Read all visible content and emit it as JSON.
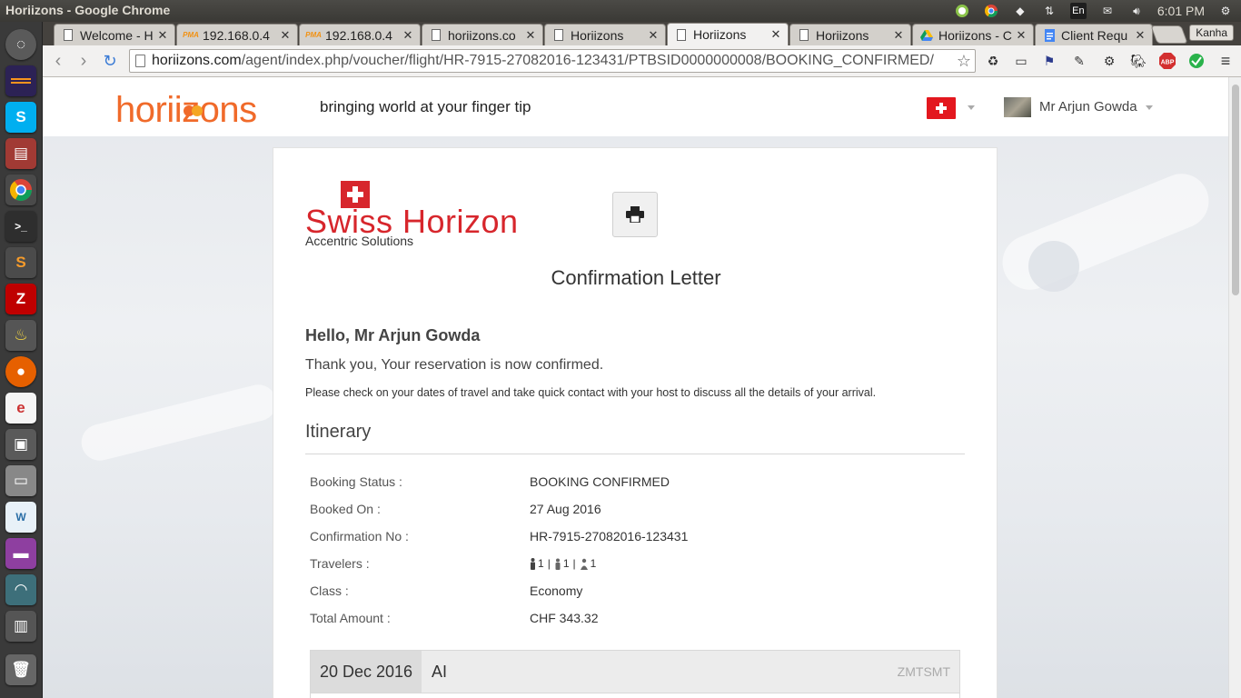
{
  "os": {
    "window_title": "Horiizons - Google Chrome",
    "keyboard": "En",
    "clock": "6:01 PM"
  },
  "launcher": {
    "items": [
      "dash-home",
      "eclipse",
      "skype",
      "files",
      "chrome",
      "terminal",
      "sublime-text",
      "filezilla",
      "unknown-app",
      "firefox",
      "editor",
      "save",
      "disk",
      "mysql-workbench",
      "media",
      "network",
      "archive",
      "trash"
    ]
  },
  "tabs": [
    {
      "label": "Welcome - H",
      "icon": "page-icon"
    },
    {
      "label": "192.168.0.4",
      "icon": "pma-icon"
    },
    {
      "label": "192.168.0.4",
      "icon": "pma-icon"
    },
    {
      "label": "horiizons.co",
      "icon": "page-icon"
    },
    {
      "label": "Horiizons",
      "icon": "page-icon"
    },
    {
      "label": "Horiizons",
      "icon": "page-icon",
      "active": true
    },
    {
      "label": "Horiizons",
      "icon": "page-icon"
    },
    {
      "label": "Horiizons - C",
      "icon": "drive-icon"
    },
    {
      "label": "Client Requ",
      "icon": "docs-icon"
    }
  ],
  "profile": "Kanha",
  "url": {
    "host": "horiizons.com",
    "path": "/agent/index.php/voucher/flight/HR-7915-27082016-123431/PTBSID0000000008/BOOKING_CONFIRMED/"
  },
  "site": {
    "logo_text": "horiizons",
    "tagline": "bringing world at your finger tip",
    "user_name": "Mr Arjun Gowda"
  },
  "letter": {
    "brand_name": "Swiss Horizon",
    "brand_sub": "Accentric Solutions",
    "title": "Confirmation Letter",
    "greeting": "Hello, Mr Arjun Gowda",
    "thanks": "Thank you, Your reservation is now confirmed.",
    "note": "Please check on your dates of travel and take quick contact with your host to discuss all the details of your arrival.",
    "itinerary_heading": "Itinerary",
    "rows": [
      {
        "label": "Booking Status :",
        "value": "BOOKING CONFIRMED"
      },
      {
        "label": "Booked On :",
        "value": "27 Aug 2016"
      },
      {
        "label": "Confirmation No :",
        "value": "HR-7915-27082016-123431"
      },
      {
        "label": "Travelers :",
        "value": ""
      },
      {
        "label": "Class :",
        "value": "Economy"
      },
      {
        "label": "Total Amount :",
        "value": "CHF 343.32"
      }
    ],
    "travelers": {
      "adults": "1",
      "children": "1",
      "infants": "1"
    },
    "flight": {
      "date": "20 Dec 2016",
      "airline": "AI",
      "code": "ZMTSMT"
    }
  },
  "colors": {
    "brand_orange": "#f06a2a",
    "swiss_red": "#d7262c",
    "flag_red": "#e3171e"
  }
}
